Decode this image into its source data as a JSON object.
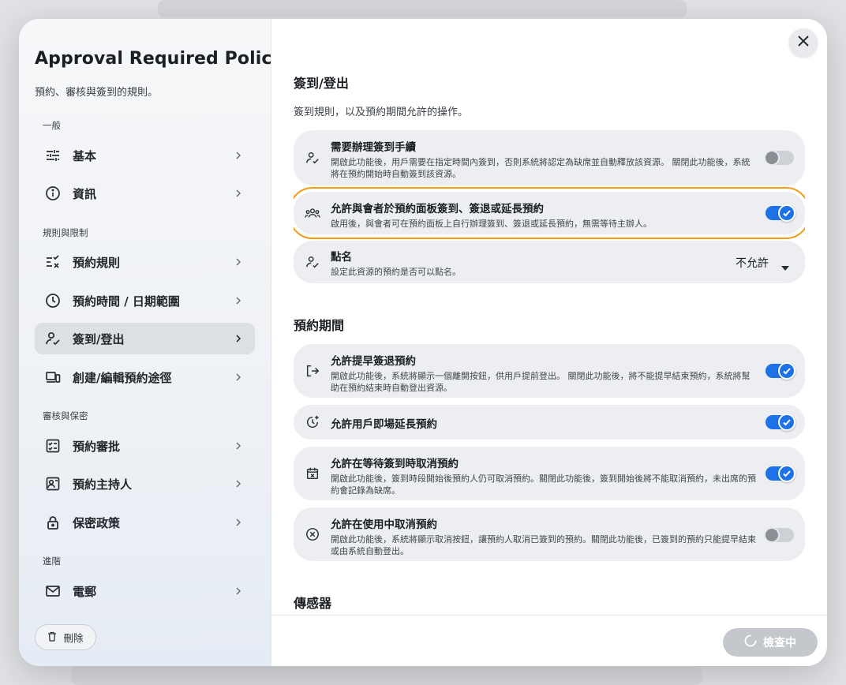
{
  "sidebar": {
    "title": "Approval Required Policy",
    "subtitle": "預約、審核與簽到的規則。",
    "sections": {
      "general": "一般",
      "rules": "規則與限制",
      "review": "審核與保密",
      "advanced": "進階"
    },
    "items": {
      "basic": "基本",
      "info": "資訊",
      "booking_rules": "預約規則",
      "time_range": "預約時間 / 日期範圍",
      "checkin": "簽到/登出",
      "channels": "創建/編輯預約途徑",
      "approval": "預約審批",
      "host": "預約主持人",
      "privacy": "保密政策",
      "email": "電郵"
    },
    "delete_label": "刪除"
  },
  "main": {
    "checkin_section": {
      "title": "簽到/登出",
      "description": "簽到規則，以及預約期間允許的操作。",
      "cards": {
        "require_checkin": {
          "title": "需要辦理簽到手續",
          "desc": "開啟此功能後，用戶需要在指定時間內簽到，否則系統將認定為缺席並自動釋放該資源。 關閉此功能後，系統將在預約開始時自動簽到該資源。",
          "enabled": false
        },
        "panel_checkin": {
          "title": "允許與會者於預約面板簽到、簽退或延長預約",
          "desc": "啟用後，與會者可在預約面板上自行辦理簽到、簽退或延長預約，無需等待主辦人。",
          "enabled": true
        },
        "roll_call": {
          "title": "點名",
          "desc": "設定此資源的預約是否可以點名。",
          "value": "不允許"
        }
      }
    },
    "period_section": {
      "title": "預約期間",
      "cards": {
        "early_checkout": {
          "title": "允許提早簽退預約",
          "desc": "開啟此功能後，系統將顯示一個離開按鈕，供用戶提前登出。 關閉此功能後，將不能提早結束預約，系統將幫助在預約結束時自動登出資源。",
          "enabled": true
        },
        "extend": {
          "title": "允許用戶即場延長預約",
          "enabled": true
        },
        "cancel_waiting": {
          "title": "允許在等待簽到時取消預約",
          "desc": "開啟此功能後，簽到時段開始後預約人仍可取消預約。關閉此功能後，簽到開始後將不能取消預約，未出席的預約會記錄為缺席。",
          "enabled": true
        },
        "cancel_in_use": {
          "title": "允許在使用中取消預約",
          "desc": "開啟此功能後，系統將顯示取消按鈕，讓預約人取消已簽到的預約。關閉此功能後，已簽到的預約只能提早結束或由系統自動登出。",
          "enabled": false
        }
      }
    },
    "sensor_section": {
      "title": "傳感器"
    },
    "footer": {
      "check_label": "檢查中"
    }
  },
  "colors": {
    "accent": "#1d72e8",
    "highlight": "#f29b13"
  }
}
